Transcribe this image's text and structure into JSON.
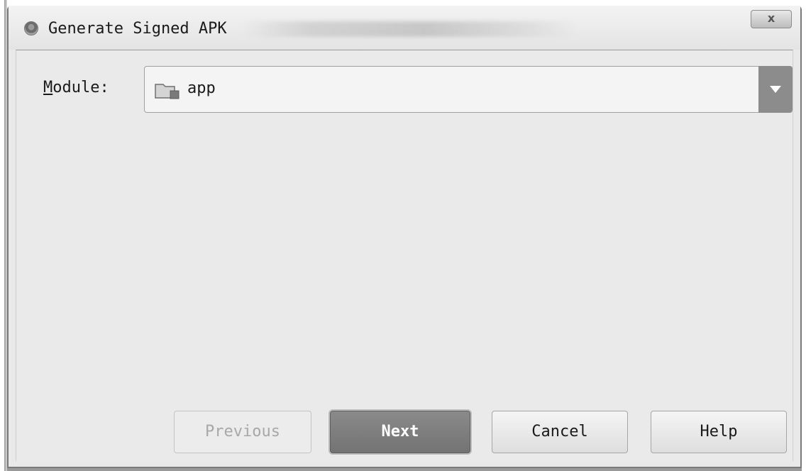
{
  "window": {
    "title": "Generate Signed APK",
    "close_label": "x"
  },
  "form": {
    "module_label_mnemonic": "M",
    "module_label_rest": "odule:",
    "module_value": "app",
    "module_icon": "folder-icon"
  },
  "buttons": {
    "previous": "Previous",
    "next": "Next",
    "cancel": "Cancel",
    "help": "Help"
  },
  "colors": {
    "primary_button": "#7f7f7f",
    "disabled_text": "#a8a8a8",
    "dialog_background": "#eaeaea"
  }
}
